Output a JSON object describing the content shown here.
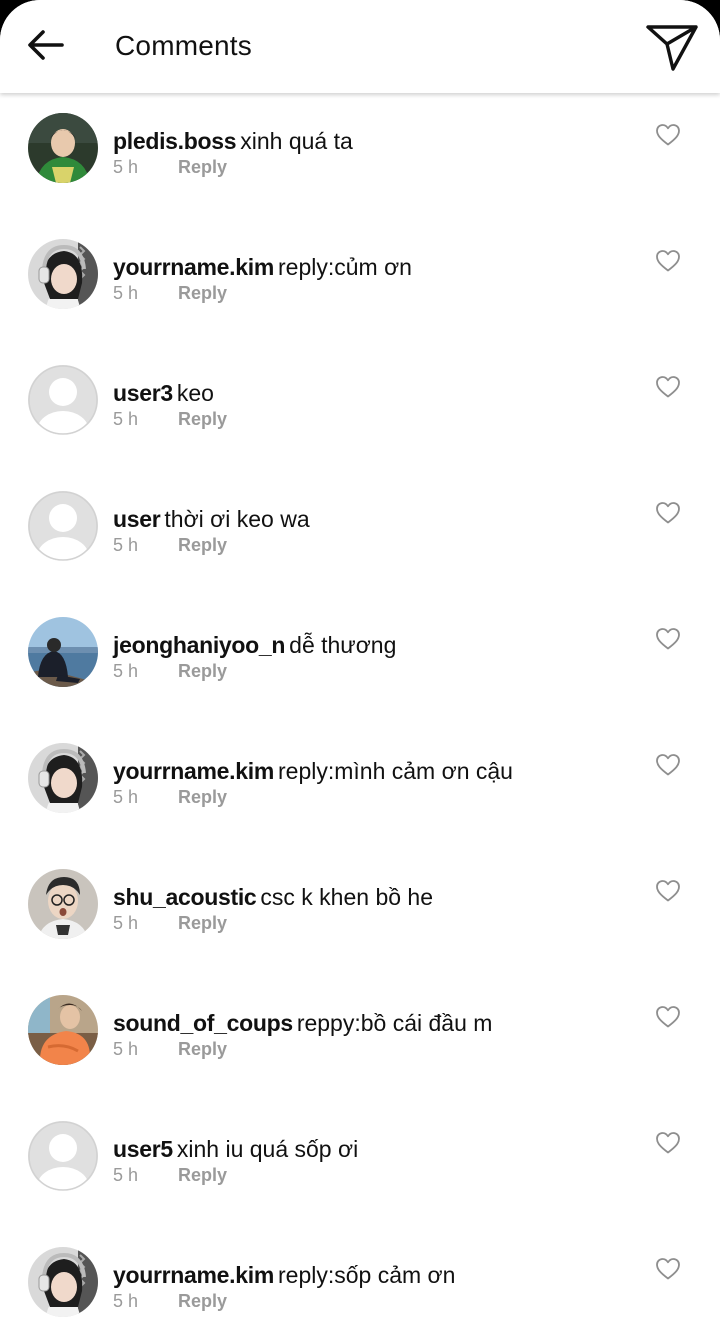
{
  "header": {
    "title": "Comments",
    "back_icon": "arrow-left-icon",
    "send_icon": "paper-plane-icon"
  },
  "comments": [
    {
      "username": "pledis.boss",
      "text": "xinh quá ta",
      "time": "5 h",
      "reply_label": "Reply",
      "avatar": "photo-green-shirt"
    },
    {
      "username": "yourrname.kim",
      "text": "reply:củm ơn",
      "time": "5 h",
      "reply_label": "Reply",
      "avatar": "photo-headphones"
    },
    {
      "username": "user3",
      "text": "keo",
      "time": "5 h",
      "reply_label": "Reply",
      "avatar": "default-avatar"
    },
    {
      "username": "user",
      "text": "thời ơi keo wa",
      "time": "5 h",
      "reply_label": "Reply",
      "avatar": "default-avatar"
    },
    {
      "username": "jeonghaniyoo_n",
      "text": "dễ thương",
      "time": "5 h",
      "reply_label": "Reply",
      "avatar": "photo-seaside"
    },
    {
      "username": "yourrname.kim",
      "text": "reply:mình cảm ơn cậu",
      "time": "5 h",
      "reply_label": "Reply",
      "avatar": "photo-headphones"
    },
    {
      "username": "shu_acoustic",
      "text": "csc k khen bồ he",
      "time": "5 h",
      "reply_label": "Reply",
      "avatar": "photo-glasses"
    },
    {
      "username": "sound_of_coups",
      "text": "reppy:bồ cái đầu m",
      "time": "5 h",
      "reply_label": "Reply",
      "avatar": "photo-orange-jacket"
    },
    {
      "username": "user5",
      "text": "xinh iu quá sốp ơi",
      "time": "5 h",
      "reply_label": "Reply",
      "avatar": "default-avatar"
    },
    {
      "username": "yourrname.kim",
      "text": "reply:sốp cảm ơn",
      "time": "5 h",
      "reply_label": "Reply",
      "avatar": "photo-headphones"
    }
  ],
  "colors": {
    "text": "#111111",
    "meta": "#9a9a9a",
    "default_avatar_bg": "#e0e0e0"
  }
}
